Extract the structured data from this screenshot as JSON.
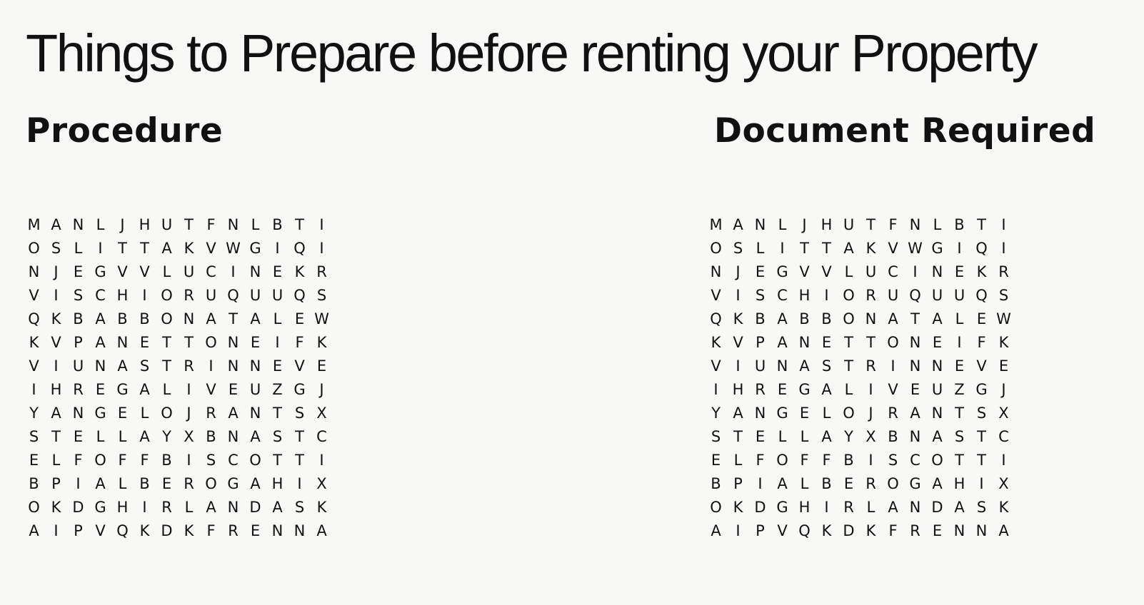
{
  "title": "Things to Prepare before renting your Property",
  "sections": {
    "left_heading": "Procedure",
    "right_heading": "Document Required"
  },
  "puzzle_rows": [
    "MANLJHUTFNLBTI",
    "OSLITTAKVWGIQI",
    "NJEGVVLUCINEKR",
    "VISCHIORUQUUQS",
    "QKBABBONATALEW",
    "KVPANETTONEIFK",
    "VIUNASTRINNEVE",
    "IHREGALIVEUZGJ",
    "YANGELOJRANTSX",
    "STELLAYXBNASTC",
    "ELFOFFBISCOTTI",
    "BPIALBEROGAHIX",
    "OKDGHIRLANDASK",
    "AIPVQKDKFRENNA"
  ]
}
